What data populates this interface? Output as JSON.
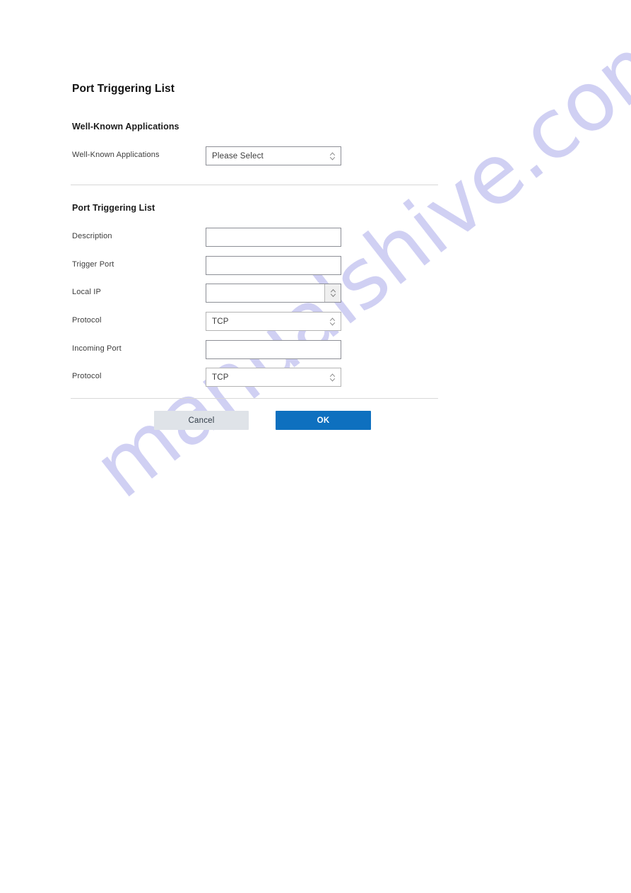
{
  "page": {
    "title": "Port Triggering List"
  },
  "watermark": {
    "text": "manualshive.com",
    "color": "#cdcdf2"
  },
  "sections": [
    {
      "heading": "Well-Known Applications",
      "rows": [
        {
          "label": "Well-Known Applications",
          "control": "select",
          "value": "Please Select",
          "icon": "spinner-chevrons-icon"
        }
      ]
    },
    {
      "heading": "Port Triggering List",
      "rows": [
        {
          "label": "Description",
          "control": "text",
          "value": "",
          "placeholder": ""
        },
        {
          "label": "Trigger Port",
          "control": "text",
          "value": "",
          "placeholder": ""
        },
        {
          "label": "Local IP",
          "control": "stepper",
          "value": "",
          "placeholder": "",
          "icon": "spinner-chevrons-icon"
        },
        {
          "label": "Protocol",
          "control": "select",
          "value": "TCP",
          "icon": "spinner-chevrons-icon"
        },
        {
          "label": "Incoming Port",
          "control": "text",
          "value": "",
          "placeholder": ""
        },
        {
          "label": "Protocol",
          "control": "select",
          "value": "TCP",
          "icon": "spinner-chevrons-icon"
        }
      ]
    }
  ],
  "buttons": {
    "cancel_label": "Cancel",
    "ok_label": "OK",
    "cancel_color": "#dfe3e8",
    "ok_color": "#0e70bf"
  }
}
